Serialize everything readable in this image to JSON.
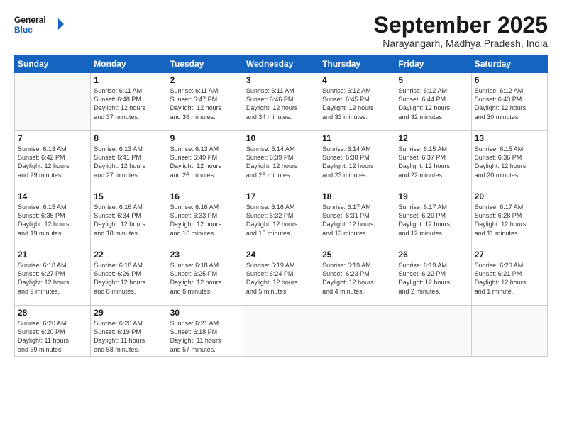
{
  "logo": {
    "line1": "General",
    "line2": "Blue"
  },
  "title": "September 2025",
  "subtitle": "Narayangarh, Madhya Pradesh, India",
  "weekdays": [
    "Sunday",
    "Monday",
    "Tuesday",
    "Wednesday",
    "Thursday",
    "Friday",
    "Saturday"
  ],
  "weeks": [
    [
      {
        "num": "",
        "info": ""
      },
      {
        "num": "1",
        "info": "Sunrise: 6:11 AM\nSunset: 6:48 PM\nDaylight: 12 hours\nand 37 minutes."
      },
      {
        "num": "2",
        "info": "Sunrise: 6:11 AM\nSunset: 6:47 PM\nDaylight: 12 hours\nand 36 minutes."
      },
      {
        "num": "3",
        "info": "Sunrise: 6:11 AM\nSunset: 6:46 PM\nDaylight: 12 hours\nand 34 minutes."
      },
      {
        "num": "4",
        "info": "Sunrise: 6:12 AM\nSunset: 6:45 PM\nDaylight: 12 hours\nand 33 minutes."
      },
      {
        "num": "5",
        "info": "Sunrise: 6:12 AM\nSunset: 6:44 PM\nDaylight: 12 hours\nand 32 minutes."
      },
      {
        "num": "6",
        "info": "Sunrise: 6:12 AM\nSunset: 6:43 PM\nDaylight: 12 hours\nand 30 minutes."
      }
    ],
    [
      {
        "num": "7",
        "info": "Sunrise: 6:13 AM\nSunset: 6:42 PM\nDaylight: 12 hours\nand 29 minutes."
      },
      {
        "num": "8",
        "info": "Sunrise: 6:13 AM\nSunset: 6:41 PM\nDaylight: 12 hours\nand 27 minutes."
      },
      {
        "num": "9",
        "info": "Sunrise: 6:13 AM\nSunset: 6:40 PM\nDaylight: 12 hours\nand 26 minutes."
      },
      {
        "num": "10",
        "info": "Sunrise: 6:14 AM\nSunset: 6:39 PM\nDaylight: 12 hours\nand 25 minutes."
      },
      {
        "num": "11",
        "info": "Sunrise: 6:14 AM\nSunset: 6:38 PM\nDaylight: 12 hours\nand 23 minutes."
      },
      {
        "num": "12",
        "info": "Sunrise: 6:15 AM\nSunset: 6:37 PM\nDaylight: 12 hours\nand 22 minutes."
      },
      {
        "num": "13",
        "info": "Sunrise: 6:15 AM\nSunset: 6:36 PM\nDaylight: 12 hours\nand 20 minutes."
      }
    ],
    [
      {
        "num": "14",
        "info": "Sunrise: 6:15 AM\nSunset: 6:35 PM\nDaylight: 12 hours\nand 19 minutes."
      },
      {
        "num": "15",
        "info": "Sunrise: 6:16 AM\nSunset: 6:34 PM\nDaylight: 12 hours\nand 18 minutes."
      },
      {
        "num": "16",
        "info": "Sunrise: 6:16 AM\nSunset: 6:33 PM\nDaylight: 12 hours\nand 16 minutes."
      },
      {
        "num": "17",
        "info": "Sunrise: 6:16 AM\nSunset: 6:32 PM\nDaylight: 12 hours\nand 15 minutes."
      },
      {
        "num": "18",
        "info": "Sunrise: 6:17 AM\nSunset: 6:31 PM\nDaylight: 12 hours\nand 13 minutes."
      },
      {
        "num": "19",
        "info": "Sunrise: 6:17 AM\nSunset: 6:29 PM\nDaylight: 12 hours\nand 12 minutes."
      },
      {
        "num": "20",
        "info": "Sunrise: 6:17 AM\nSunset: 6:28 PM\nDaylight: 12 hours\nand 11 minutes."
      }
    ],
    [
      {
        "num": "21",
        "info": "Sunrise: 6:18 AM\nSunset: 6:27 PM\nDaylight: 12 hours\nand 9 minutes."
      },
      {
        "num": "22",
        "info": "Sunrise: 6:18 AM\nSunset: 6:26 PM\nDaylight: 12 hours\nand 8 minutes."
      },
      {
        "num": "23",
        "info": "Sunrise: 6:18 AM\nSunset: 6:25 PM\nDaylight: 12 hours\nand 6 minutes."
      },
      {
        "num": "24",
        "info": "Sunrise: 6:19 AM\nSunset: 6:24 PM\nDaylight: 12 hours\nand 5 minutes."
      },
      {
        "num": "25",
        "info": "Sunrise: 6:19 AM\nSunset: 6:23 PM\nDaylight: 12 hours\nand 4 minutes."
      },
      {
        "num": "26",
        "info": "Sunrise: 6:19 AM\nSunset: 6:22 PM\nDaylight: 12 hours\nand 2 minutes."
      },
      {
        "num": "27",
        "info": "Sunrise: 6:20 AM\nSunset: 6:21 PM\nDaylight: 12 hours\nand 1 minute."
      }
    ],
    [
      {
        "num": "28",
        "info": "Sunrise: 6:20 AM\nSunset: 6:20 PM\nDaylight: 11 hours\nand 59 minutes."
      },
      {
        "num": "29",
        "info": "Sunrise: 6:20 AM\nSunset: 6:19 PM\nDaylight: 11 hours\nand 58 minutes."
      },
      {
        "num": "30",
        "info": "Sunrise: 6:21 AM\nSunset: 6:18 PM\nDaylight: 11 hours\nand 57 minutes."
      },
      {
        "num": "",
        "info": ""
      },
      {
        "num": "",
        "info": ""
      },
      {
        "num": "",
        "info": ""
      },
      {
        "num": "",
        "info": ""
      }
    ]
  ]
}
